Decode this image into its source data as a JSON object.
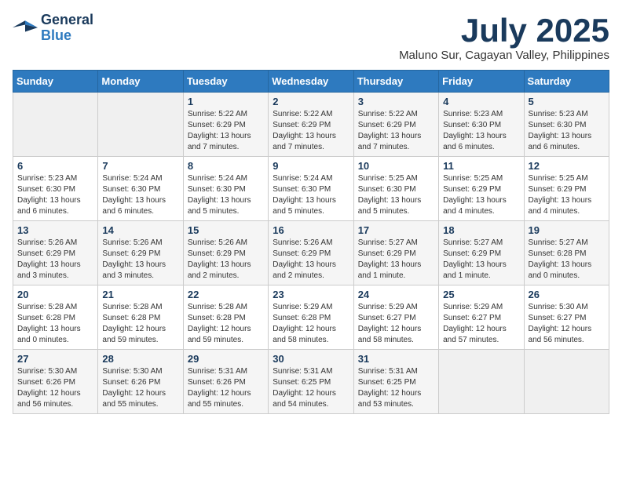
{
  "header": {
    "logo_line1": "General",
    "logo_line2": "Blue",
    "month": "July 2025",
    "location": "Maluno Sur, Cagayan Valley, Philippines"
  },
  "weekdays": [
    "Sunday",
    "Monday",
    "Tuesday",
    "Wednesday",
    "Thursday",
    "Friday",
    "Saturday"
  ],
  "weeks": [
    [
      {
        "day": "",
        "info": ""
      },
      {
        "day": "",
        "info": ""
      },
      {
        "day": "1",
        "info": "Sunrise: 5:22 AM\nSunset: 6:29 PM\nDaylight: 13 hours and 7 minutes."
      },
      {
        "day": "2",
        "info": "Sunrise: 5:22 AM\nSunset: 6:29 PM\nDaylight: 13 hours and 7 minutes."
      },
      {
        "day": "3",
        "info": "Sunrise: 5:22 AM\nSunset: 6:29 PM\nDaylight: 13 hours and 7 minutes."
      },
      {
        "day": "4",
        "info": "Sunrise: 5:23 AM\nSunset: 6:30 PM\nDaylight: 13 hours and 6 minutes."
      },
      {
        "day": "5",
        "info": "Sunrise: 5:23 AM\nSunset: 6:30 PM\nDaylight: 13 hours and 6 minutes."
      }
    ],
    [
      {
        "day": "6",
        "info": "Sunrise: 5:23 AM\nSunset: 6:30 PM\nDaylight: 13 hours and 6 minutes."
      },
      {
        "day": "7",
        "info": "Sunrise: 5:24 AM\nSunset: 6:30 PM\nDaylight: 13 hours and 6 minutes."
      },
      {
        "day": "8",
        "info": "Sunrise: 5:24 AM\nSunset: 6:30 PM\nDaylight: 13 hours and 5 minutes."
      },
      {
        "day": "9",
        "info": "Sunrise: 5:24 AM\nSunset: 6:30 PM\nDaylight: 13 hours and 5 minutes."
      },
      {
        "day": "10",
        "info": "Sunrise: 5:25 AM\nSunset: 6:30 PM\nDaylight: 13 hours and 5 minutes."
      },
      {
        "day": "11",
        "info": "Sunrise: 5:25 AM\nSunset: 6:29 PM\nDaylight: 13 hours and 4 minutes."
      },
      {
        "day": "12",
        "info": "Sunrise: 5:25 AM\nSunset: 6:29 PM\nDaylight: 13 hours and 4 minutes."
      }
    ],
    [
      {
        "day": "13",
        "info": "Sunrise: 5:26 AM\nSunset: 6:29 PM\nDaylight: 13 hours and 3 minutes."
      },
      {
        "day": "14",
        "info": "Sunrise: 5:26 AM\nSunset: 6:29 PM\nDaylight: 13 hours and 3 minutes."
      },
      {
        "day": "15",
        "info": "Sunrise: 5:26 AM\nSunset: 6:29 PM\nDaylight: 13 hours and 2 minutes."
      },
      {
        "day": "16",
        "info": "Sunrise: 5:26 AM\nSunset: 6:29 PM\nDaylight: 13 hours and 2 minutes."
      },
      {
        "day": "17",
        "info": "Sunrise: 5:27 AM\nSunset: 6:29 PM\nDaylight: 13 hours and 1 minute."
      },
      {
        "day": "18",
        "info": "Sunrise: 5:27 AM\nSunset: 6:29 PM\nDaylight: 13 hours and 1 minute."
      },
      {
        "day": "19",
        "info": "Sunrise: 5:27 AM\nSunset: 6:28 PM\nDaylight: 13 hours and 0 minutes."
      }
    ],
    [
      {
        "day": "20",
        "info": "Sunrise: 5:28 AM\nSunset: 6:28 PM\nDaylight: 13 hours and 0 minutes."
      },
      {
        "day": "21",
        "info": "Sunrise: 5:28 AM\nSunset: 6:28 PM\nDaylight: 12 hours and 59 minutes."
      },
      {
        "day": "22",
        "info": "Sunrise: 5:28 AM\nSunset: 6:28 PM\nDaylight: 12 hours and 59 minutes."
      },
      {
        "day": "23",
        "info": "Sunrise: 5:29 AM\nSunset: 6:28 PM\nDaylight: 12 hours and 58 minutes."
      },
      {
        "day": "24",
        "info": "Sunrise: 5:29 AM\nSunset: 6:27 PM\nDaylight: 12 hours and 58 minutes."
      },
      {
        "day": "25",
        "info": "Sunrise: 5:29 AM\nSunset: 6:27 PM\nDaylight: 12 hours and 57 minutes."
      },
      {
        "day": "26",
        "info": "Sunrise: 5:30 AM\nSunset: 6:27 PM\nDaylight: 12 hours and 56 minutes."
      }
    ],
    [
      {
        "day": "27",
        "info": "Sunrise: 5:30 AM\nSunset: 6:26 PM\nDaylight: 12 hours and 56 minutes."
      },
      {
        "day": "28",
        "info": "Sunrise: 5:30 AM\nSunset: 6:26 PM\nDaylight: 12 hours and 55 minutes."
      },
      {
        "day": "29",
        "info": "Sunrise: 5:31 AM\nSunset: 6:26 PM\nDaylight: 12 hours and 55 minutes."
      },
      {
        "day": "30",
        "info": "Sunrise: 5:31 AM\nSunset: 6:25 PM\nDaylight: 12 hours and 54 minutes."
      },
      {
        "day": "31",
        "info": "Sunrise: 5:31 AM\nSunset: 6:25 PM\nDaylight: 12 hours and 53 minutes."
      },
      {
        "day": "",
        "info": ""
      },
      {
        "day": "",
        "info": ""
      }
    ]
  ]
}
